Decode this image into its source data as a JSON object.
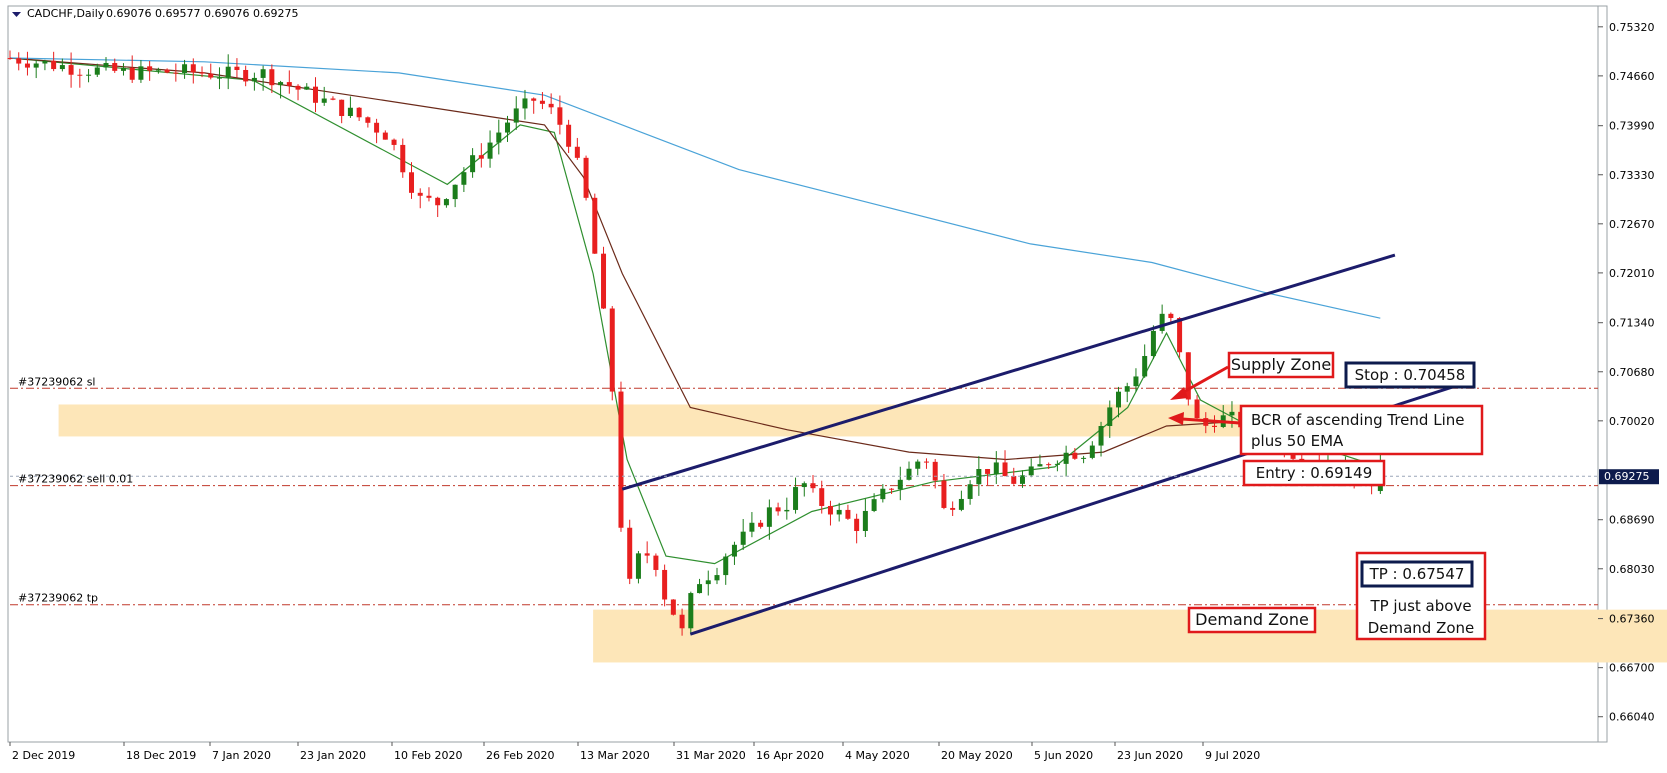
{
  "header": {
    "symbol": "CADCHF,Daily",
    "ohlc": "0.69076 0.69577 0.69076 0.69275"
  },
  "colors": {
    "bull": "#1b7d1b",
    "bear": "#e81f1f",
    "ema_fast": "#2f8f2f",
    "ema_50": "#6b2a1a",
    "ma_200": "#4aa3d8",
    "channel": "#1c1c6b",
    "zone": "#fde6b8",
    "order_line": "#c0392b",
    "annotation_border": "#e0191b",
    "price_box": "#0d1b4d"
  },
  "chart_data": {
    "type": "candlestick",
    "symbol": "CADCHF",
    "timeframe": "Daily",
    "last_ohlc": {
      "open": 0.69076,
      "high": 0.69577,
      "low": 0.69076,
      "close": 0.69275
    },
    "ylim": [
      0.657,
      0.756
    ],
    "y_ticks": [
      "0.75320",
      "0.74660",
      "0.73990",
      "0.73330",
      "0.72670",
      "0.72010",
      "0.71340",
      "0.70680",
      "0.70020",
      "0.68690",
      "0.68030",
      "0.67360",
      "0.66700",
      "0.66040"
    ],
    "current_price": "0.69275",
    "x_ticks": [
      "2 Dec 2019",
      "18 Dec 2019",
      "7 Jan 2020",
      "23 Jan 2020",
      "10 Feb 2020",
      "26 Feb 2020",
      "13 Mar 2020",
      "31 Mar 2020",
      "16 Apr 2020",
      "4 May 2020",
      "20 May 2020",
      "5 Jun 2020",
      "23 Jun 2020",
      "9 Jul 2020"
    ],
    "close_path": [
      [
        0,
        0.749
      ],
      [
        15,
        0.7475
      ],
      [
        25,
        0.747
      ],
      [
        35,
        0.7472
      ],
      [
        45,
        0.7468
      ],
      [
        52,
        0.747
      ],
      [
        62,
        0.744
      ],
      [
        72,
        0.741
      ],
      [
        78,
        0.7385
      ],
      [
        84,
        0.73
      ],
      [
        88,
        0.7295
      ],
      [
        93,
        0.7335
      ],
      [
        98,
        0.737
      ],
      [
        103,
        0.741
      ],
      [
        108,
        0.7435
      ],
      [
        112,
        0.7415
      ],
      [
        115,
        0.738
      ],
      [
        118,
        0.732
      ],
      [
        121,
        0.72
      ],
      [
        123,
        0.71
      ],
      [
        124,
        0.704
      ],
      [
        125,
        0.693
      ],
      [
        126,
        0.684
      ],
      [
        127,
        0.677
      ],
      [
        128,
        0.679
      ],
      [
        130,
        0.683
      ],
      [
        133,
        0.681
      ],
      [
        135,
        0.676
      ],
      [
        137,
        0.674
      ],
      [
        138,
        0.671
      ],
      [
        140,
        0.676
      ],
      [
        142,
        0.679
      ],
      [
        145,
        0.68
      ],
      [
        148,
        0.683
      ],
      [
        152,
        0.685
      ],
      [
        156,
        0.688
      ],
      [
        160,
        0.689
      ],
      [
        163,
        0.692
      ],
      [
        166,
        0.6895
      ],
      [
        170,
        0.688
      ],
      [
        174,
        0.686
      ],
      [
        178,
        0.689
      ],
      [
        182,
        0.692
      ],
      [
        186,
        0.694
      ],
      [
        188,
        0.696
      ],
      [
        190,
        0.693
      ],
      [
        192,
        0.688
      ],
      [
        195,
        0.69
      ],
      [
        198,
        0.693
      ],
      [
        202,
        0.694
      ],
      [
        206,
        0.692
      ],
      [
        210,
        0.693
      ],
      [
        214,
        0.695
      ],
      [
        218,
        0.696
      ],
      [
        221,
        0.696
      ],
      [
        224,
        0.699
      ],
      [
        227,
        0.703
      ],
      [
        230,
        0.705
      ],
      [
        233,
        0.708
      ],
      [
        235,
        0.712
      ],
      [
        237,
        0.714
      ],
      [
        239,
        0.7135
      ],
      [
        241,
        0.708
      ],
      [
        243,
        0.702
      ],
      [
        245,
        0.699
      ],
      [
        248,
        0.7005
      ],
      [
        251,
        0.7005
      ],
      [
        255,
        0.6995
      ],
      [
        258,
        0.699
      ],
      [
        261,
        0.6975
      ],
      [
        264,
        0.696
      ],
      [
        267,
        0.695
      ],
      [
        270,
        0.6945
      ],
      [
        273,
        0.694
      ],
      [
        276,
        0.693
      ],
      [
        279,
        0.6915
      ],
      [
        282,
        0.6928
      ]
    ],
    "candle_count": 158,
    "series": [
      {
        "kind": "moving_average",
        "color": "ema_fast",
        "values": [
          [
            0,
            0.749
          ],
          [
            50,
            0.746
          ],
          [
            90,
            0.732
          ],
          [
            105,
            0.74
          ],
          [
            112,
            0.739
          ],
          [
            120,
            0.72
          ],
          [
            127,
            0.695
          ],
          [
            135,
            0.682
          ],
          [
            145,
            0.681
          ],
          [
            165,
            0.688
          ],
          [
            190,
            0.692
          ],
          [
            215,
            0.694
          ],
          [
            230,
            0.702
          ],
          [
            238,
            0.712
          ],
          [
            245,
            0.703
          ],
          [
            255,
            0.6995
          ],
          [
            270,
            0.6965
          ],
          [
            282,
            0.694
          ]
        ]
      },
      {
        "kind": "moving_average",
        "color": "ema_50",
        "values": [
          [
            0,
            0.749
          ],
          [
            40,
            0.747
          ],
          [
            70,
            0.744
          ],
          [
            100,
            0.741
          ],
          [
            110,
            0.74
          ],
          [
            118,
            0.733
          ],
          [
            126,
            0.72
          ],
          [
            140,
            0.702
          ],
          [
            160,
            0.699
          ],
          [
            185,
            0.696
          ],
          [
            205,
            0.695
          ],
          [
            225,
            0.696
          ],
          [
            238,
            0.6995
          ],
          [
            250,
            0.7
          ],
          [
            265,
            0.699
          ],
          [
            282,
            0.6975
          ]
        ]
      },
      {
        "kind": "moving_average",
        "color": "ma_200",
        "values": [
          [
            0,
            0.749
          ],
          [
            40,
            0.7485
          ],
          [
            80,
            0.747
          ],
          [
            110,
            0.744
          ],
          [
            130,
            0.739
          ],
          [
            150,
            0.734
          ],
          [
            180,
            0.729
          ],
          [
            210,
            0.724
          ],
          [
            235,
            0.7215
          ],
          [
            258,
            0.7175
          ],
          [
            282,
            0.714
          ]
        ]
      }
    ],
    "channel": {
      "upper": [
        [
          126,
          0.691
        ],
        [
          285,
          0.7225
        ]
      ],
      "lower": [
        [
          140,
          0.6715
        ],
        [
          298,
          0.705
        ]
      ]
    },
    "zones": [
      {
        "id": "supply",
        "low": 0.6981,
        "high": 0.7024,
        "x_start": 10,
        "x_end": 290
      },
      {
        "id": "demand",
        "low": 0.6677,
        "high": 0.6748,
        "x_start": 120,
        "x_end": 352
      }
    ],
    "order_lines": [
      {
        "label": "#37239062 sl",
        "price": 0.70458
      },
      {
        "label": "#37239062 sell 0.01",
        "price": 0.69149
      },
      {
        "label": "#37239062 tp",
        "price": 0.67547
      }
    ],
    "annotations": {
      "supply_zone": "Supply Zone",
      "bcr_line1": "BCR of ascending Trend Line",
      "bcr_line2": "plus 50 EMA",
      "stop": "Stop : 0.70458",
      "entry": "Entry : 0.69149",
      "tp": "TP : 0.67547",
      "tp_note_line1": "TP just above",
      "tp_note_line2": "Demand Zone",
      "demand_zone": "Demand Zone"
    }
  }
}
